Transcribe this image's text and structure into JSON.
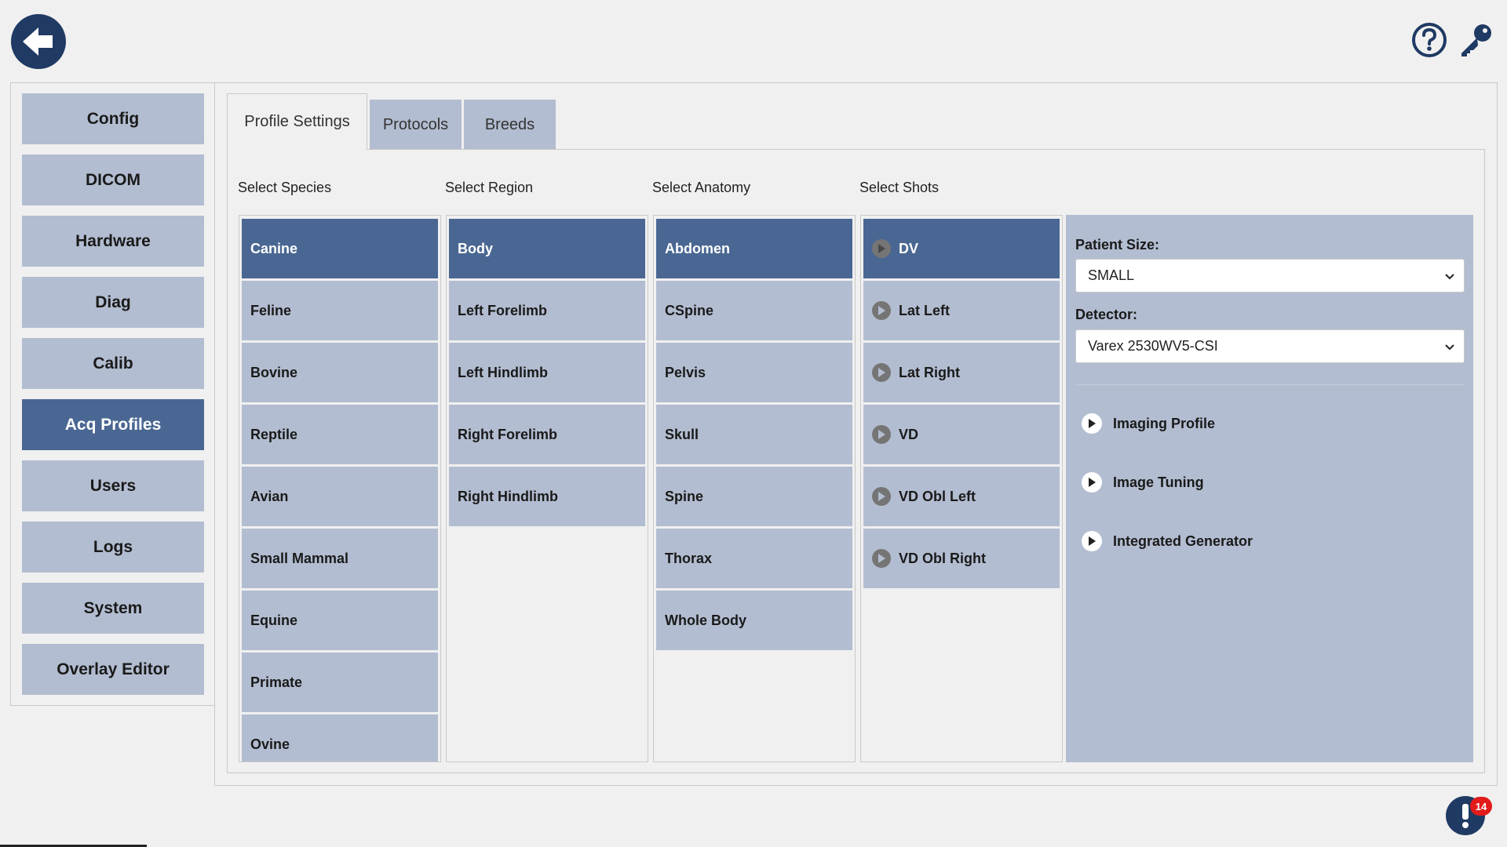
{
  "header": {
    "back_icon": "arrow-left-icon",
    "help_icon": "help-icon",
    "key_icon": "key-icon"
  },
  "sidebar": {
    "items": [
      {
        "label": "Config"
      },
      {
        "label": "DICOM"
      },
      {
        "label": "Hardware"
      },
      {
        "label": "Diag"
      },
      {
        "label": "Calib"
      },
      {
        "label": "Acq Profiles",
        "active": true
      },
      {
        "label": "Users"
      },
      {
        "label": "Logs"
      },
      {
        "label": "System"
      },
      {
        "label": "Overlay Editor"
      }
    ]
  },
  "tabs": [
    {
      "label": "Profile Settings",
      "active": true
    },
    {
      "label": "Protocols"
    },
    {
      "label": "Breeds"
    }
  ],
  "columns": {
    "species": {
      "label": "Select Species",
      "items": [
        "Canine",
        "Feline",
        "Bovine",
        "Reptile",
        "Avian",
        "Small Mammal",
        "Equine",
        "Primate",
        "Ovine"
      ],
      "selected": "Canine"
    },
    "region": {
      "label": "Select Region",
      "items": [
        "Body",
        "Left Forelimb",
        "Left Hindlimb",
        "Right Forelimb",
        "Right Hindlimb"
      ],
      "selected": "Body"
    },
    "anatomy": {
      "label": "Select Anatomy",
      "items": [
        "Abdomen",
        "CSpine",
        "Pelvis",
        "Skull",
        "Spine",
        "Thorax",
        "Whole Body"
      ],
      "selected": "Abdomen"
    },
    "shots": {
      "label": "Select Shots",
      "items": [
        "DV",
        "Lat Left",
        "Lat Right",
        "VD",
        "VD Obl Left",
        "VD Obl Right"
      ],
      "selected": "DV"
    }
  },
  "settings": {
    "patient_size_label": "Patient Size:",
    "patient_size_value": "SMALL",
    "detector_label": "Detector:",
    "detector_value": "Varex 2530WV5-CSI",
    "sections": [
      "Imaging Profile",
      "Image Tuning",
      "Integrated Generator"
    ]
  },
  "notifications": {
    "count": "14"
  },
  "colors": {
    "accent": "#4a6793",
    "item_bg": "#b3bdd1",
    "dark_blue": "#1f3a63",
    "badge": "#e21b1b"
  }
}
